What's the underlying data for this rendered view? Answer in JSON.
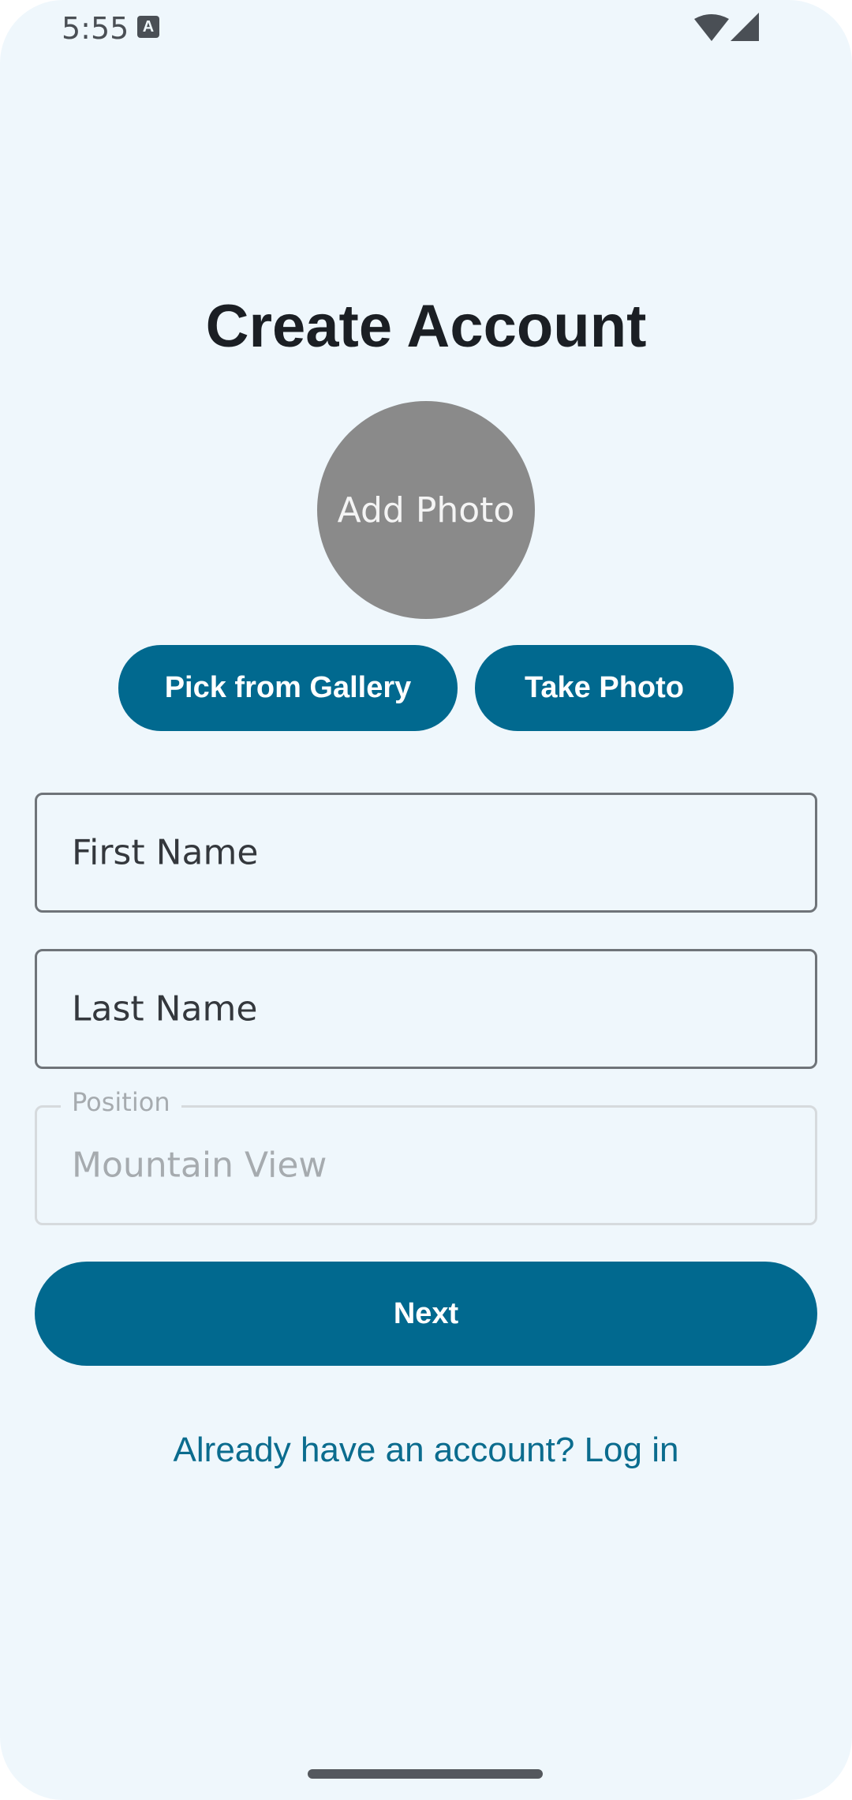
{
  "status_bar": {
    "time": "5:55",
    "notification_glyph": "A",
    "icons": [
      "keyboard-notification-icon",
      "wifi-icon",
      "signal-icon"
    ]
  },
  "page": {
    "title": "Create Account"
  },
  "avatar": {
    "label": "Add Photo"
  },
  "photo_actions": {
    "gallery_label": "Pick from Gallery",
    "camera_label": "Take Photo"
  },
  "form": {
    "first_name_placeholder": "First Name",
    "last_name_placeholder": "Last Name",
    "position_label": "Position",
    "position_value": "Mountain View"
  },
  "actions": {
    "next_label": "Next",
    "login_link": "Already have an account? Log in"
  },
  "colors": {
    "background": "#eff7fc",
    "primary": "#01698f",
    "avatar": "#8a8a8a",
    "title": "#1b1f24"
  }
}
